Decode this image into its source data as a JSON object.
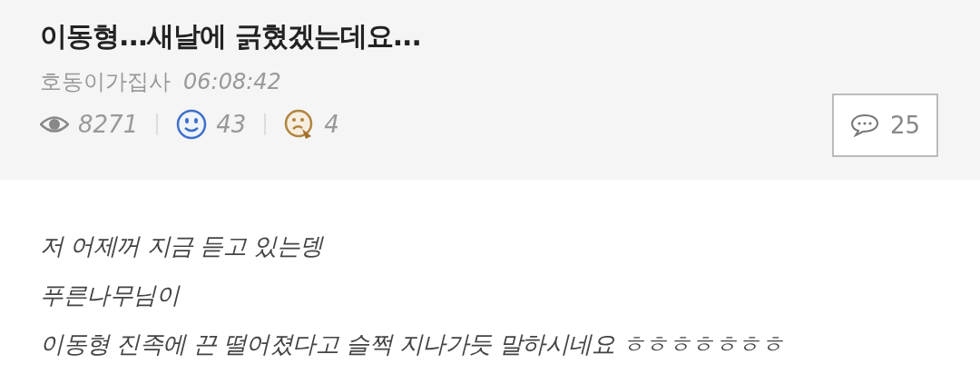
{
  "post": {
    "title": "이동형...새날에 긁혔겠는데요...",
    "author": "호동이가집사",
    "time": "06:08:42",
    "views": "8271",
    "likes": "43",
    "dislikes": "4",
    "comments": "25"
  },
  "body": [
    "저 어제꺼 지금 듣고 있는뎅",
    "푸른나무님이",
    "이동형 진족에 끈 떨어졌다고 슬쩍 지나가듯 말하시네요 ㅎㅎㅎㅎㅎㅎㅎ"
  ]
}
